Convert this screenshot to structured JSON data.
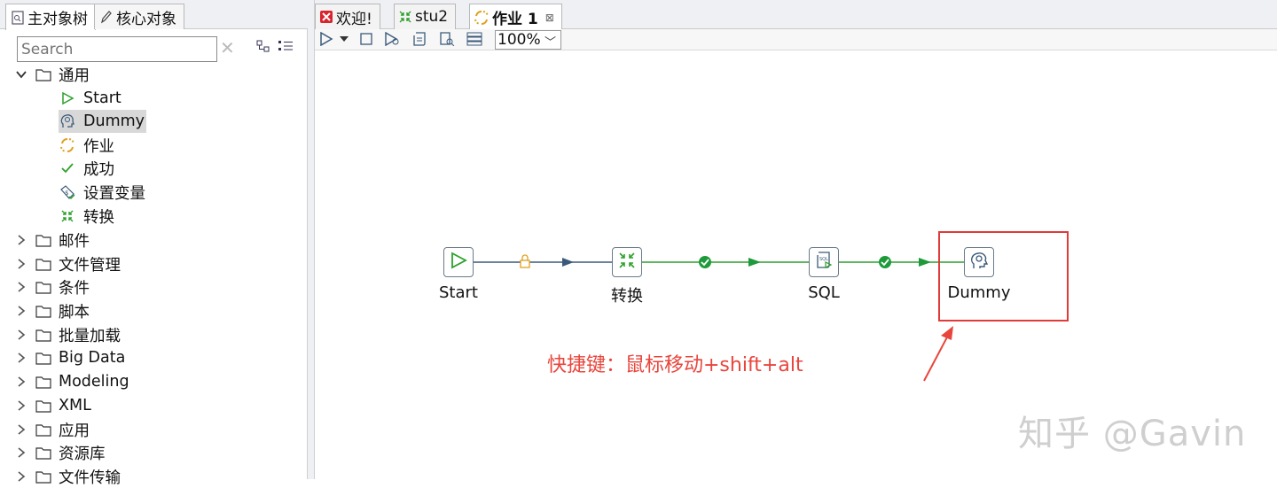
{
  "left_panel": {
    "tabs": [
      {
        "label": "主对象树",
        "icon": "doc-tree-icon"
      },
      {
        "label": "核心对象",
        "icon": "pencil-icon"
      }
    ],
    "search": {
      "placeholder": "Search",
      "value": "Search"
    },
    "tree": [
      {
        "label": "通用",
        "expanded": true,
        "children": [
          {
            "label": "Start",
            "icon": "start-triangle-icon"
          },
          {
            "label": "Dummy",
            "icon": "dummy-head-icon",
            "selected": true
          },
          {
            "label": "作业",
            "icon": "job-icon"
          },
          {
            "label": "成功",
            "icon": "success-check-icon"
          },
          {
            "label": "设置变量",
            "icon": "set-variable-icon"
          },
          {
            "label": "转换",
            "icon": "transformation-icon"
          }
        ]
      },
      {
        "label": "邮件"
      },
      {
        "label": "文件管理"
      },
      {
        "label": "条件"
      },
      {
        "label": "脚本"
      },
      {
        "label": "批量加载"
      },
      {
        "label": "Big Data"
      },
      {
        "label": "Modeling"
      },
      {
        "label": "XML"
      },
      {
        "label": "应用"
      },
      {
        "label": "资源库"
      },
      {
        "label": "文件传输"
      }
    ]
  },
  "editor": {
    "tabs": [
      {
        "label": "欢迎!",
        "icon": "welcome-icon"
      },
      {
        "label": "stu2",
        "icon": "transformation-icon"
      },
      {
        "label": "作业 1",
        "icon": "job-icon",
        "active": true,
        "close": "⊠"
      }
    ],
    "toolbar": {
      "zoom": "100%"
    },
    "nodes": [
      {
        "label": "Start",
        "icon": "start-triangle-icon"
      },
      {
        "label": "转换",
        "icon": "transformation-icon"
      },
      {
        "label": "SQL",
        "icon": "sql-script-icon"
      },
      {
        "label": "Dummy",
        "icon": "dummy-head-icon"
      }
    ],
    "annotation": "快捷键：鼠标移动+shift+alt",
    "watermark": "知乎 @Gavin",
    "colors": {
      "hop_ok": "#2ca02c",
      "hop_unconditional": "#3b5a7a",
      "lock": "#e0a01e",
      "highlight": "#e03a3a"
    }
  }
}
